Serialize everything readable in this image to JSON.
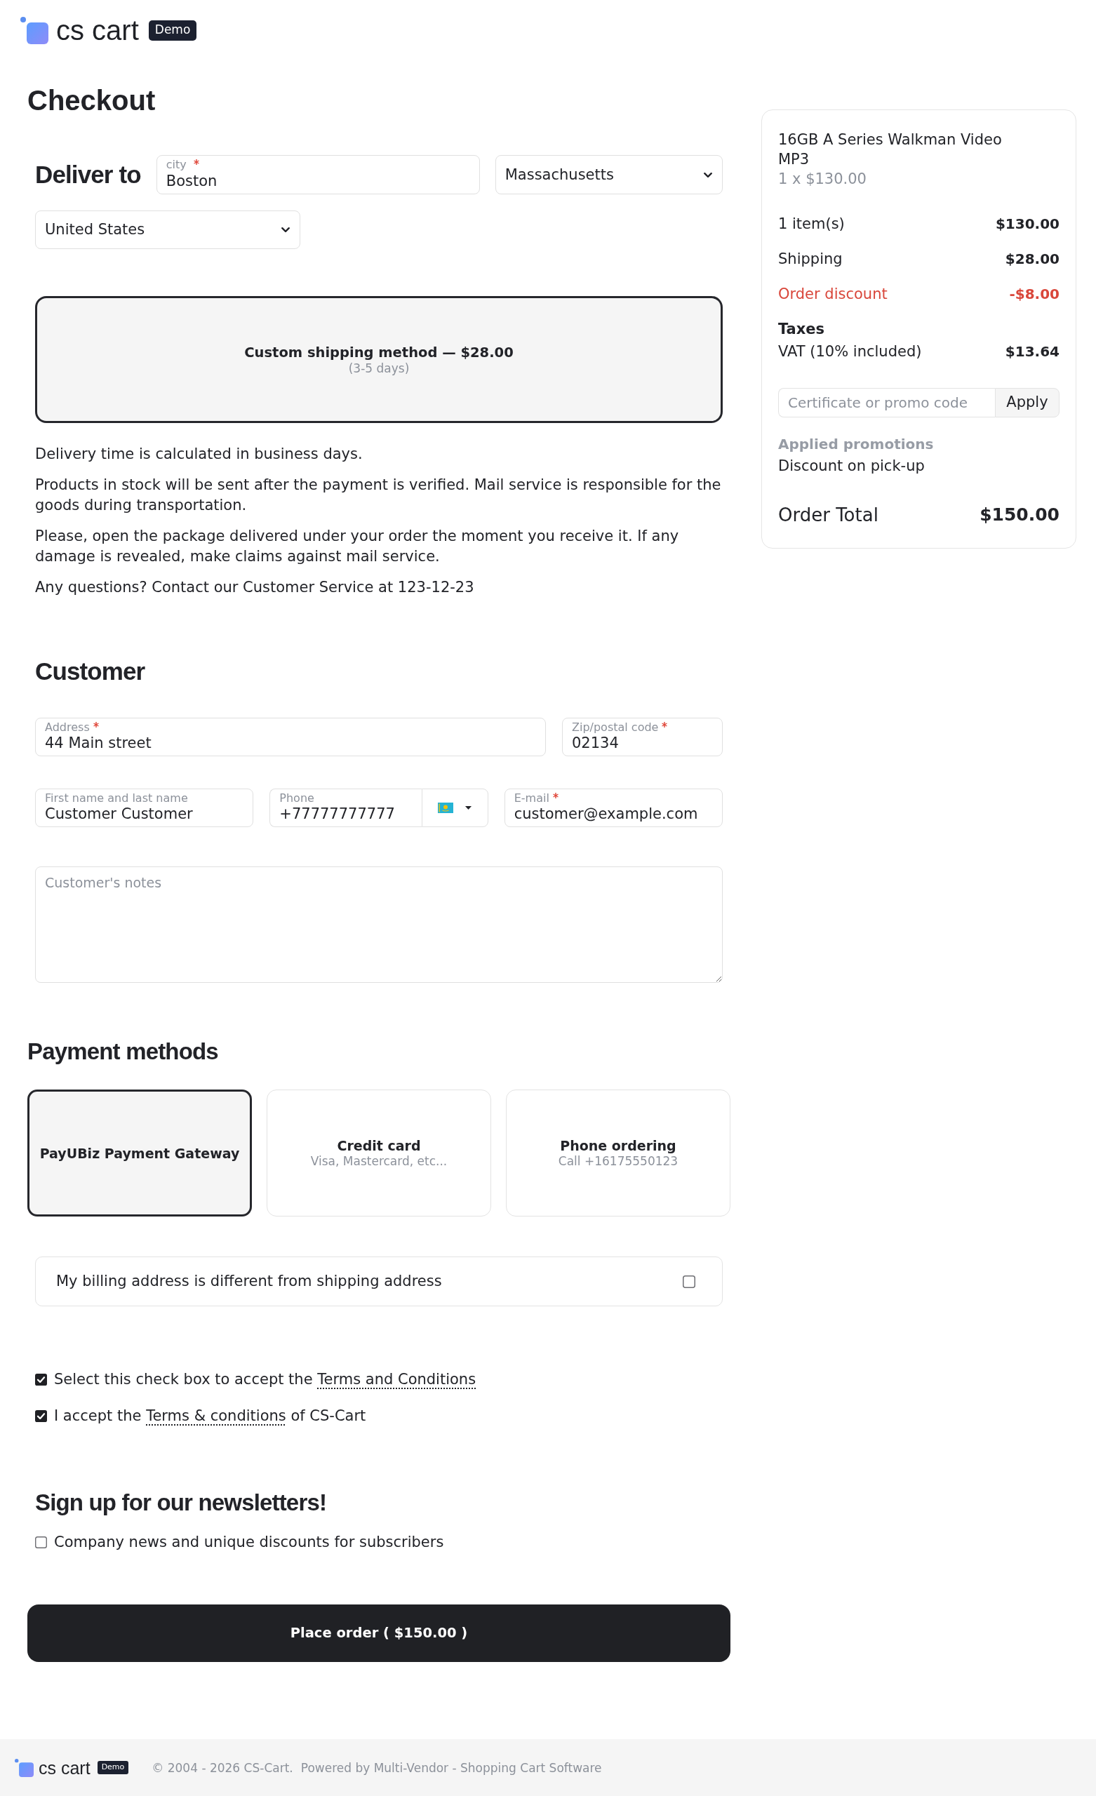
{
  "header": {
    "logo_text": "cs cart",
    "badge": "Demo"
  },
  "page_title": "Checkout",
  "delivery": {
    "title": "Deliver to",
    "city": {
      "label": "city",
      "required": true,
      "value": "Boston"
    },
    "state": {
      "value": "Massachusetts"
    },
    "country": {
      "value": "United States"
    }
  },
  "shipping_methods": [
    {
      "name": "Custom shipping method — $28.00",
      "note": "(3-5 days)",
      "selected": true
    }
  ],
  "shipping_info": [
    "Delivery time is calculated in business days.",
    "Products in stock will be sent after the payment is verified. Mail service is responsible for the goods during transportation.",
    "Please, open the package delivered under your order the moment you receive it. If any damage is revealed, make claims against mail service.",
    "Any questions? Contact our Customer Service at 123-12-23"
  ],
  "customer": {
    "title": "Customer",
    "field_rows": [
      [
        {
          "kind": "text",
          "label": "Address",
          "required": true,
          "value": "44 Main street"
        },
        {
          "kind": "text",
          "label": "Zip/postal code",
          "required": true,
          "value": "02134"
        }
      ],
      [
        {
          "kind": "text",
          "label": "First name and last name",
          "required": false,
          "value": "Customer Customer"
        },
        {
          "kind": "phone",
          "label": "Phone",
          "required": false,
          "value": "+77777777777"
        },
        {
          "kind": "text",
          "label": "E-mail",
          "required": true,
          "value": "customer@example.com"
        }
      ]
    ],
    "notes": {
      "placeholder": "Customer's notes"
    }
  },
  "payment": {
    "title": "Payment methods",
    "methods": [
      {
        "name": "PayUBiz Payment Gateway",
        "selected": true
      },
      {
        "name": "Credit card",
        "description": "Visa, Mastercard, etc...",
        "selected": false
      },
      {
        "name": "Phone ordering",
        "description": "Call +16175550123",
        "selected": false
      }
    ]
  },
  "billing_option": {
    "label": "My billing address is different from shipping address",
    "checked": false
  },
  "agreements": [
    {
      "text": "Select this check box to accept the",
      "link": "Terms and Conditions",
      "checked": true
    },
    {
      "text": "I accept the",
      "link": "Terms & conditions",
      "after": "of CS-Cart",
      "checked": true
    }
  ],
  "newsletter": {
    "title": "Sign up for our newsletters!",
    "options": [
      {
        "label": "Company news and unique discounts for subscribers",
        "checked": false
      }
    ]
  },
  "place_order": {
    "label": "Place order ( $150.00 )"
  },
  "summary": {
    "products": [
      {
        "name": "16GB A Series Walkman Video MP3",
        "price": "1 x $130.00"
      }
    ],
    "rows": [
      {
        "kind": "normal",
        "label": "1 item(s)",
        "value": "$130.00"
      },
      {
        "kind": "normal",
        "label": "Shipping",
        "value": "$28.00"
      },
      {
        "kind": "discount",
        "label": "Order discount",
        "value": "-$8.00"
      }
    ],
    "taxes": {
      "title": "Taxes",
      "items": [
        {
          "label": "VAT (10% included)",
          "value": "$13.64"
        }
      ]
    },
    "promo": {
      "placeholder": "Certificate or promo code",
      "button": "Apply"
    },
    "promotions": {
      "title": "Applied promotions",
      "items": [
        "Discount on pick-up"
      ]
    },
    "total": {
      "label": "Order Total",
      "value": "$150.00"
    }
  },
  "footer": {
    "logo_text": "cs cart",
    "badge": "Demo",
    "copyright": "© 2004 - 2026 CS-Cart.",
    "powered_by": "Powered by Multi-Vendor - Shopping Cart Software"
  }
}
